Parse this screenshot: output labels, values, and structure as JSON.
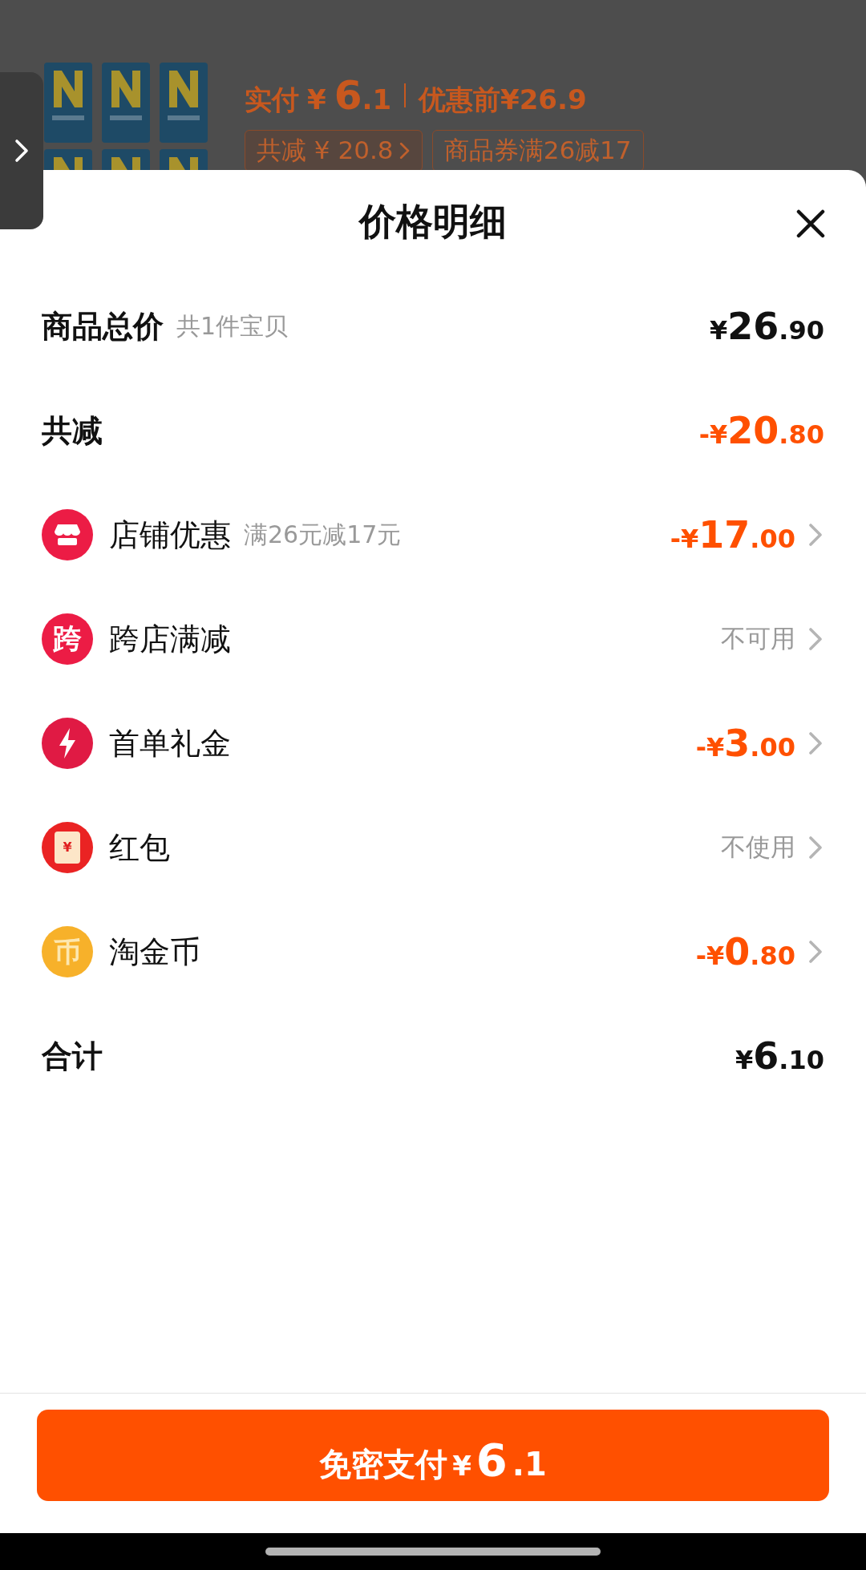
{
  "background": {
    "paid_label": "实付",
    "paid_currency": "¥",
    "paid_whole": "6",
    "paid_fraction": ".1",
    "before_price": "优惠前¥26.9",
    "chips": [
      {
        "kind": "link",
        "text": "共减 ¥ 20.8"
      },
      {
        "kind": "tag",
        "text": "商品券满26减17"
      }
    ]
  },
  "sheet": {
    "title": "价格明细",
    "rows": [
      {
        "kind": "total",
        "label": "商品总价",
        "note": "共1件宝贝",
        "amount": {
          "color": "#111111",
          "prefix": "¥",
          "whole": "26",
          "fraction": ".90"
        }
      },
      {
        "kind": "total",
        "label": "共减",
        "amount": {
          "color": "#ff5000",
          "prefix": "-¥",
          "whole": "20",
          "fraction": ".80"
        }
      },
      {
        "kind": "store",
        "label": "店铺优惠",
        "note": "满26元减17元",
        "amount": {
          "color": "#ff5000",
          "prefix": "-¥",
          "whole": "17",
          "fraction": ".00"
        }
      },
      {
        "kind": "badge",
        "icon_text": "跨",
        "label": "跨店满减",
        "status": "不可用"
      },
      {
        "kind": "bolt",
        "label": "首单礼金",
        "amount": {
          "color": "#ff5000",
          "prefix": "-¥",
          "whole": "3",
          "fraction": ".00"
        }
      },
      {
        "kind": "packet",
        "icon_text": "¥",
        "label": "红包",
        "status": "不使用"
      },
      {
        "kind": "coin",
        "icon_text": "币",
        "label": "淘金币",
        "amount": {
          "color": "#ff5000",
          "prefix": "-¥",
          "whole": "0",
          "fraction": ".80"
        }
      },
      {
        "kind": "total",
        "label": "合计",
        "amount": {
          "color": "#111111",
          "prefix": "¥",
          "whole": "6",
          "fraction": ".10"
        }
      }
    ],
    "pay_button": {
      "label": "免密支付",
      "prefix": "¥",
      "whole": "6",
      "fraction": ".1"
    }
  }
}
